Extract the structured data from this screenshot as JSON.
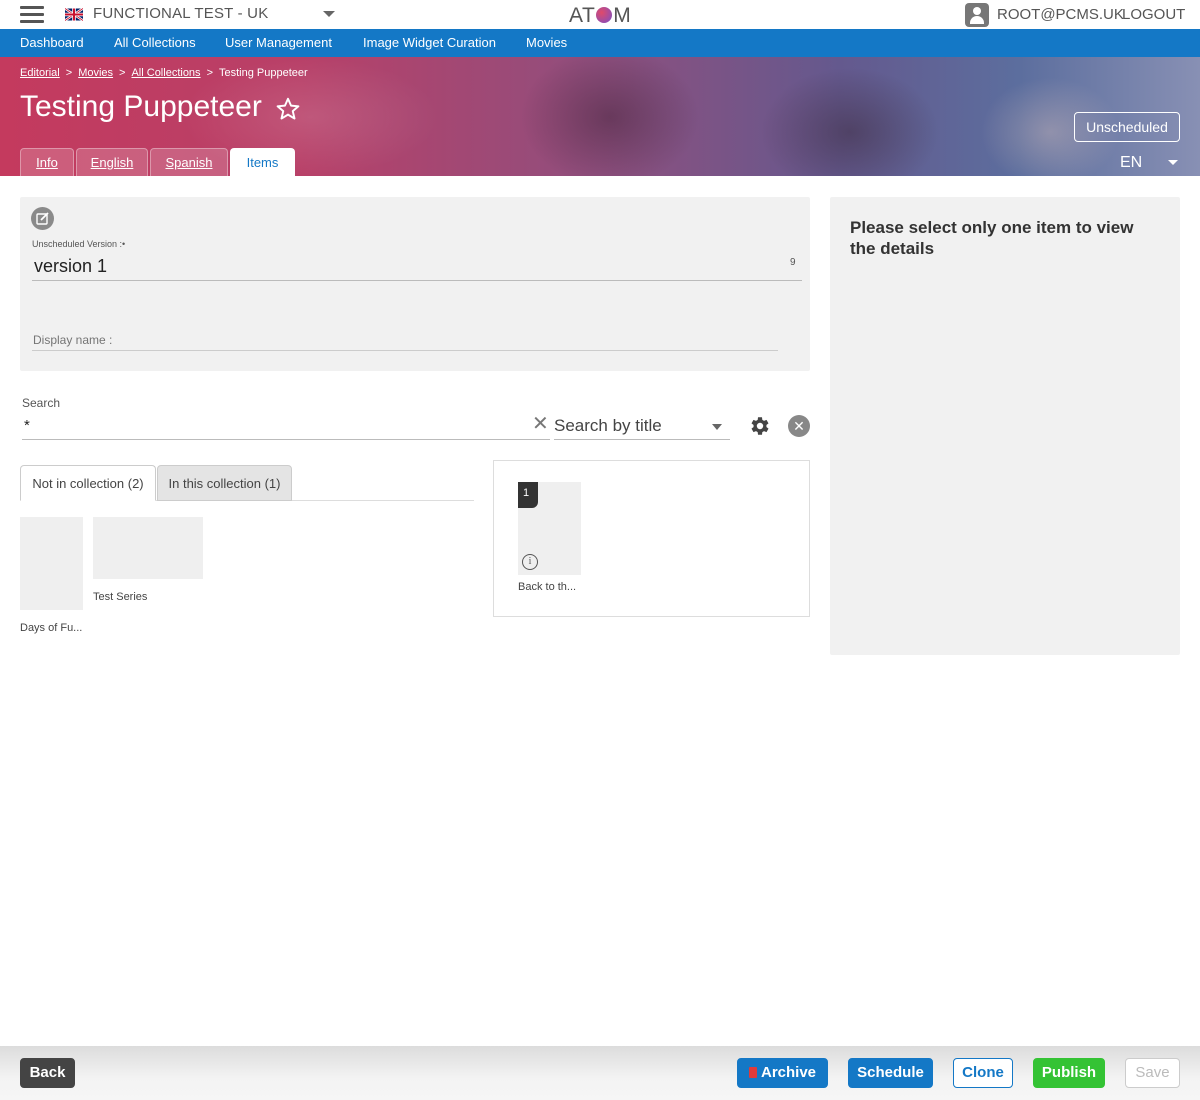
{
  "header": {
    "tenant": "FUNCTIONAL TEST - UK",
    "logo": {
      "left": "AT",
      "right": "M"
    },
    "user": "ROOT@PCMS.UK",
    "logout": "LOGOUT"
  },
  "nav": [
    "Dashboard",
    "All Collections",
    "User Management",
    "Image Widget Curation",
    "Movies"
  ],
  "breadcrumb": [
    "Editorial",
    "Movies",
    "All Collections",
    "Testing Puppeteer"
  ],
  "page": {
    "title": "Testing Puppeteer",
    "status": "Unscheduled",
    "language": "EN"
  },
  "tabs": [
    "Info",
    "English",
    "Spanish",
    "Items"
  ],
  "version": {
    "label": "Unscheduled Version :•",
    "value": "version 1",
    "char_count": "9",
    "display_name_placeholder": "Display name :"
  },
  "search": {
    "label": "Search",
    "value": "*",
    "clear": "✕",
    "mode": "Search by title"
  },
  "list_tabs": [
    "Not in collection (2)",
    "In this collection (1)"
  ],
  "available_items": [
    "Days of Fu...",
    "Test Series"
  ],
  "collection_items": [
    {
      "position": "1",
      "caption": "Back to th..."
    }
  ],
  "details": {
    "message": "Please select only one item to view the details"
  },
  "footer": {
    "back": "Back",
    "archive": "Archive",
    "schedule": "Schedule",
    "clone": "Clone",
    "publish": "Publish",
    "save": "Save"
  },
  "colors": {
    "primary": "#1478c6",
    "publish": "#34c334",
    "hero_start": "#c43a5e",
    "hero_end": "#8890b4"
  }
}
